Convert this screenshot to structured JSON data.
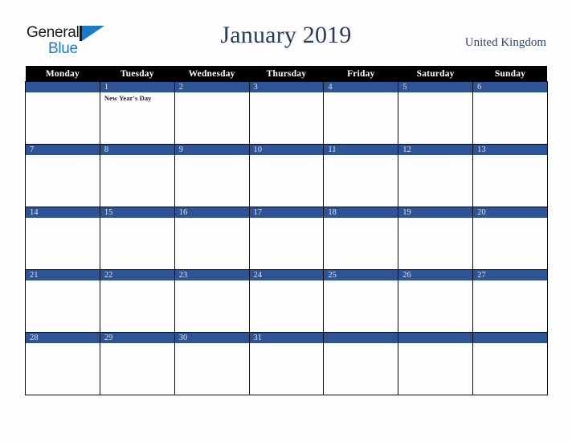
{
  "logo": {
    "word_one": "General",
    "word_two": "Blue",
    "mark": "blue-triangle",
    "accent_blue": "#1f7ac4",
    "dark": "#1b1b1b"
  },
  "header": {
    "month_title": "January 2019",
    "country": "United Kingdom",
    "title_color": "#27395f"
  },
  "calendar": {
    "colors": {
      "weekday_header_bg": "#000000",
      "weekday_header_text": "#ffffff",
      "date_bar_bg": "#2e5496",
      "date_bar_text": "#dfe4f0",
      "cell_bg": "#fdfdfd",
      "grid_line": "#0a0a0a"
    },
    "weekdays": [
      "Monday",
      "Tuesday",
      "Wednesday",
      "Thursday",
      "Friday",
      "Saturday",
      "Sunday"
    ],
    "weeks": [
      [
        {
          "day": "",
          "event": ""
        },
        {
          "day": "1",
          "event": "New Year's Day"
        },
        {
          "day": "2",
          "event": ""
        },
        {
          "day": "3",
          "event": ""
        },
        {
          "day": "4",
          "event": ""
        },
        {
          "day": "5",
          "event": ""
        },
        {
          "day": "6",
          "event": ""
        }
      ],
      [
        {
          "day": "7",
          "event": ""
        },
        {
          "day": "8",
          "event": ""
        },
        {
          "day": "9",
          "event": ""
        },
        {
          "day": "10",
          "event": ""
        },
        {
          "day": "11",
          "event": ""
        },
        {
          "day": "12",
          "event": ""
        },
        {
          "day": "13",
          "event": ""
        }
      ],
      [
        {
          "day": "14",
          "event": ""
        },
        {
          "day": "15",
          "event": ""
        },
        {
          "day": "16",
          "event": ""
        },
        {
          "day": "17",
          "event": ""
        },
        {
          "day": "18",
          "event": ""
        },
        {
          "day": "19",
          "event": ""
        },
        {
          "day": "20",
          "event": ""
        }
      ],
      [
        {
          "day": "21",
          "event": ""
        },
        {
          "day": "22",
          "event": ""
        },
        {
          "day": "23",
          "event": ""
        },
        {
          "day": "24",
          "event": ""
        },
        {
          "day": "25",
          "event": ""
        },
        {
          "day": "26",
          "event": ""
        },
        {
          "day": "27",
          "event": ""
        }
      ],
      [
        {
          "day": "28",
          "event": ""
        },
        {
          "day": "29",
          "event": ""
        },
        {
          "day": "30",
          "event": ""
        },
        {
          "day": "31",
          "event": ""
        },
        {
          "day": "",
          "event": ""
        },
        {
          "day": "",
          "event": ""
        },
        {
          "day": "",
          "event": ""
        }
      ]
    ]
  }
}
